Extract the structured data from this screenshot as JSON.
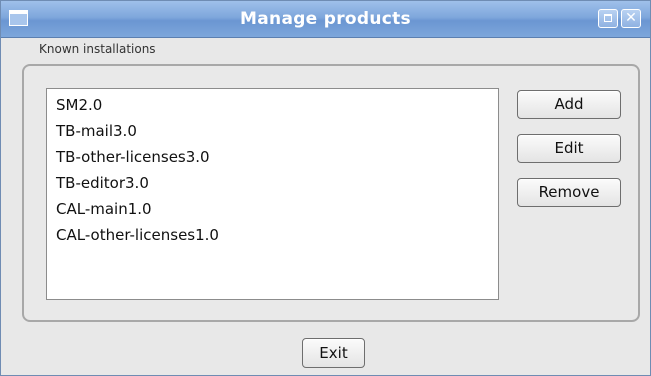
{
  "window": {
    "title": "Manage products",
    "icons": {
      "menu": "window-menu-icon",
      "maximize": "maximize-icon",
      "close": "close-icon"
    },
    "colors": {
      "titlebar": "#7fa7dc",
      "title_text": "#ffffff",
      "background": "#e8e8e8"
    }
  },
  "group": {
    "label": "Known installations"
  },
  "installations": [
    "SM2.0",
    "TB-mail3.0",
    "TB-other-licenses3.0",
    "TB-editor3.0",
    "CAL-main1.0",
    "CAL-other-licenses1.0"
  ],
  "buttons": {
    "add": "Add",
    "edit": "Edit",
    "remove": "Remove",
    "exit": "Exit"
  }
}
